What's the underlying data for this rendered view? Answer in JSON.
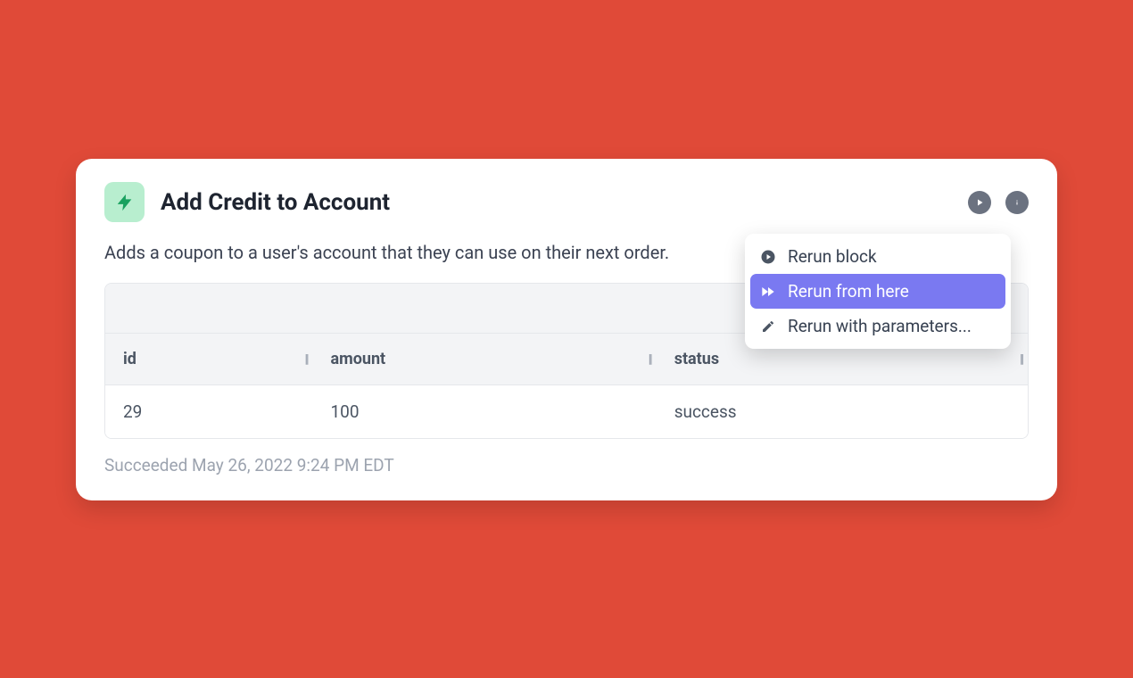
{
  "block": {
    "title": "Add Credit to Account",
    "description": "Adds a coupon to a user's account that they can use on their next order.",
    "status_line": "Succeeded May 26, 2022 9:24 PM EDT"
  },
  "menu": {
    "items": [
      {
        "label": "Rerun block",
        "icon": "play",
        "active": false
      },
      {
        "label": "Rerun from here",
        "icon": "fast-forward",
        "active": true
      },
      {
        "label": "Rerun with parameters...",
        "icon": "pencil",
        "active": false
      }
    ]
  },
  "table": {
    "columns": [
      "id",
      "amount",
      "status"
    ],
    "rows": [
      {
        "id": "29",
        "amount": "100",
        "status": "success"
      }
    ]
  }
}
